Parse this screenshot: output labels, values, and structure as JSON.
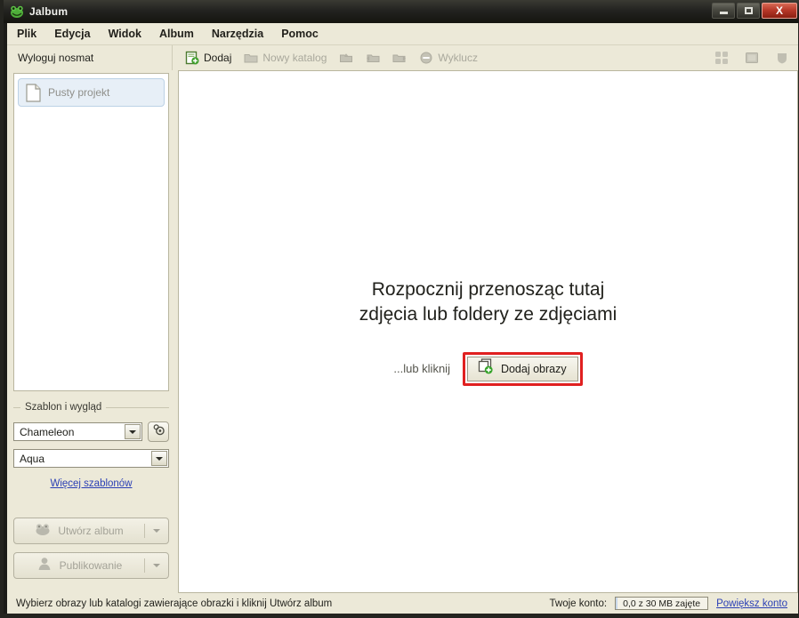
{
  "window": {
    "title": "Jalbum",
    "app_icon": "frog-icon",
    "controls": {
      "minimize": "minimize-icon",
      "maximize": "maximize-icon",
      "close": "X"
    }
  },
  "menubar": {
    "items": [
      {
        "label": "Plik",
        "name": "menu-plik"
      },
      {
        "label": "Edycja",
        "name": "menu-edycja"
      },
      {
        "label": "Widok",
        "name": "menu-widok"
      },
      {
        "label": "Album",
        "name": "menu-album"
      },
      {
        "label": "Narzędzia",
        "name": "menu-narzedzia"
      },
      {
        "label": "Pomoc",
        "name": "menu-pomoc"
      }
    ]
  },
  "toolbar": {
    "logout_label": "Wyloguj nosmat",
    "add_label": "Dodaj",
    "new_folder_label": "Nowy katalog",
    "exclude_label": "Wyklucz",
    "nav_icons": [
      "folder-up-icon",
      "folder-back-icon",
      "folder-forward-icon"
    ],
    "view_modes": [
      "grid-view-icon",
      "single-view-icon",
      "folder-view-icon"
    ]
  },
  "sidebar": {
    "project": {
      "label": "Pusty projekt",
      "icon": "document-icon"
    },
    "template_group": {
      "title": "Szablon i wygląd",
      "skin_value": "Chameleon",
      "style_value": "Aqua",
      "settings_icon": "gear-icon",
      "more_link": "Więcej szablonów"
    },
    "actions": [
      {
        "label": "Utwórz album",
        "icon": "frog-icon",
        "name": "create-album-button"
      },
      {
        "label": "Publikowanie",
        "icon": "publish-icon",
        "name": "publish-button"
      }
    ]
  },
  "main": {
    "dropzone": {
      "line1": "Rozpocznij przenosząc tutaj",
      "line2": "zdjęcia lub foldery ze zdjęciami",
      "click_text": "...lub kliknij",
      "button_label": "Dodaj obrazy",
      "button_icon": "add-images-icon",
      "highlight_color": "#e02020"
    }
  },
  "statusbar": {
    "message": "Wybierz obrazy lub katalogi zawierające obrazki i kliknij Utwórz album",
    "account_label": "Twoje konto:",
    "quota_text": "0,0 z 30 MB zajęte",
    "upgrade_link": "Powiększ konto"
  }
}
